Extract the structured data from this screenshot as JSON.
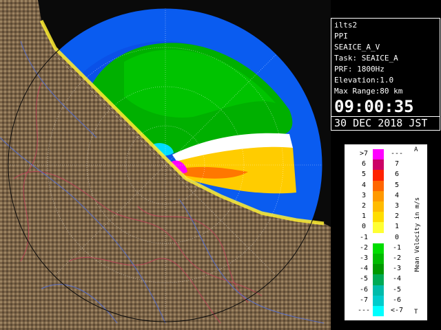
{
  "info": {
    "lines": [
      "ilts2",
      "PPI",
      "SEAICE_A_V",
      "Task: SEAICE_A",
      "PRF: 1800Hz",
      "Elevation:1.0",
      "Max Range:80 km"
    ],
    "time": "09:00:35",
    "date": "30 DEC 2018 JST"
  },
  "legend": {
    "title": "Mean Velocity in m/s",
    "corner_top": "A",
    "corner_bottom": "T",
    "rows": [
      {
        "l1": ">7",
        "l2": "---",
        "color": "#ff00ff"
      },
      {
        "l1": "6",
        "l2": "7",
        "color": "#cc0066"
      },
      {
        "l1": "5",
        "l2": "6",
        "color": "#ff2200"
      },
      {
        "l1": "4",
        "l2": "5",
        "color": "#ff6600"
      },
      {
        "l1": "3",
        "l2": "4",
        "color": "#ff9900"
      },
      {
        "l1": "2",
        "l2": "3",
        "color": "#ffbb00"
      },
      {
        "l1": "1",
        "l2": "2",
        "color": "#ffdd00"
      },
      {
        "l1": "0",
        "l2": "1",
        "color": "#ffff33"
      },
      {
        "l1": "-1",
        "l2": "0",
        "color": "#ffffff"
      },
      {
        "l1": "-2",
        "l2": "-1",
        "color": "#00dd00"
      },
      {
        "l1": "-3",
        "l2": "-2",
        "color": "#00bb00"
      },
      {
        "l1": "-4",
        "l2": "-3",
        "color": "#009900"
      },
      {
        "l1": "-5",
        "l2": "-4",
        "color": "#00aa55"
      },
      {
        "l1": "-6",
        "l2": "-5",
        "color": "#00bbaa"
      },
      {
        "l1": "-7",
        "l2": "-6",
        "color": "#00cccc"
      },
      {
        "l1": "---",
        "l2": "<-7",
        "color": "#00ffff"
      }
    ]
  },
  "colors": {
    "range_blue": "#0066ff",
    "range_dark": "#0033cc",
    "land": "#8a7050",
    "sea": "#0a0a0a"
  }
}
